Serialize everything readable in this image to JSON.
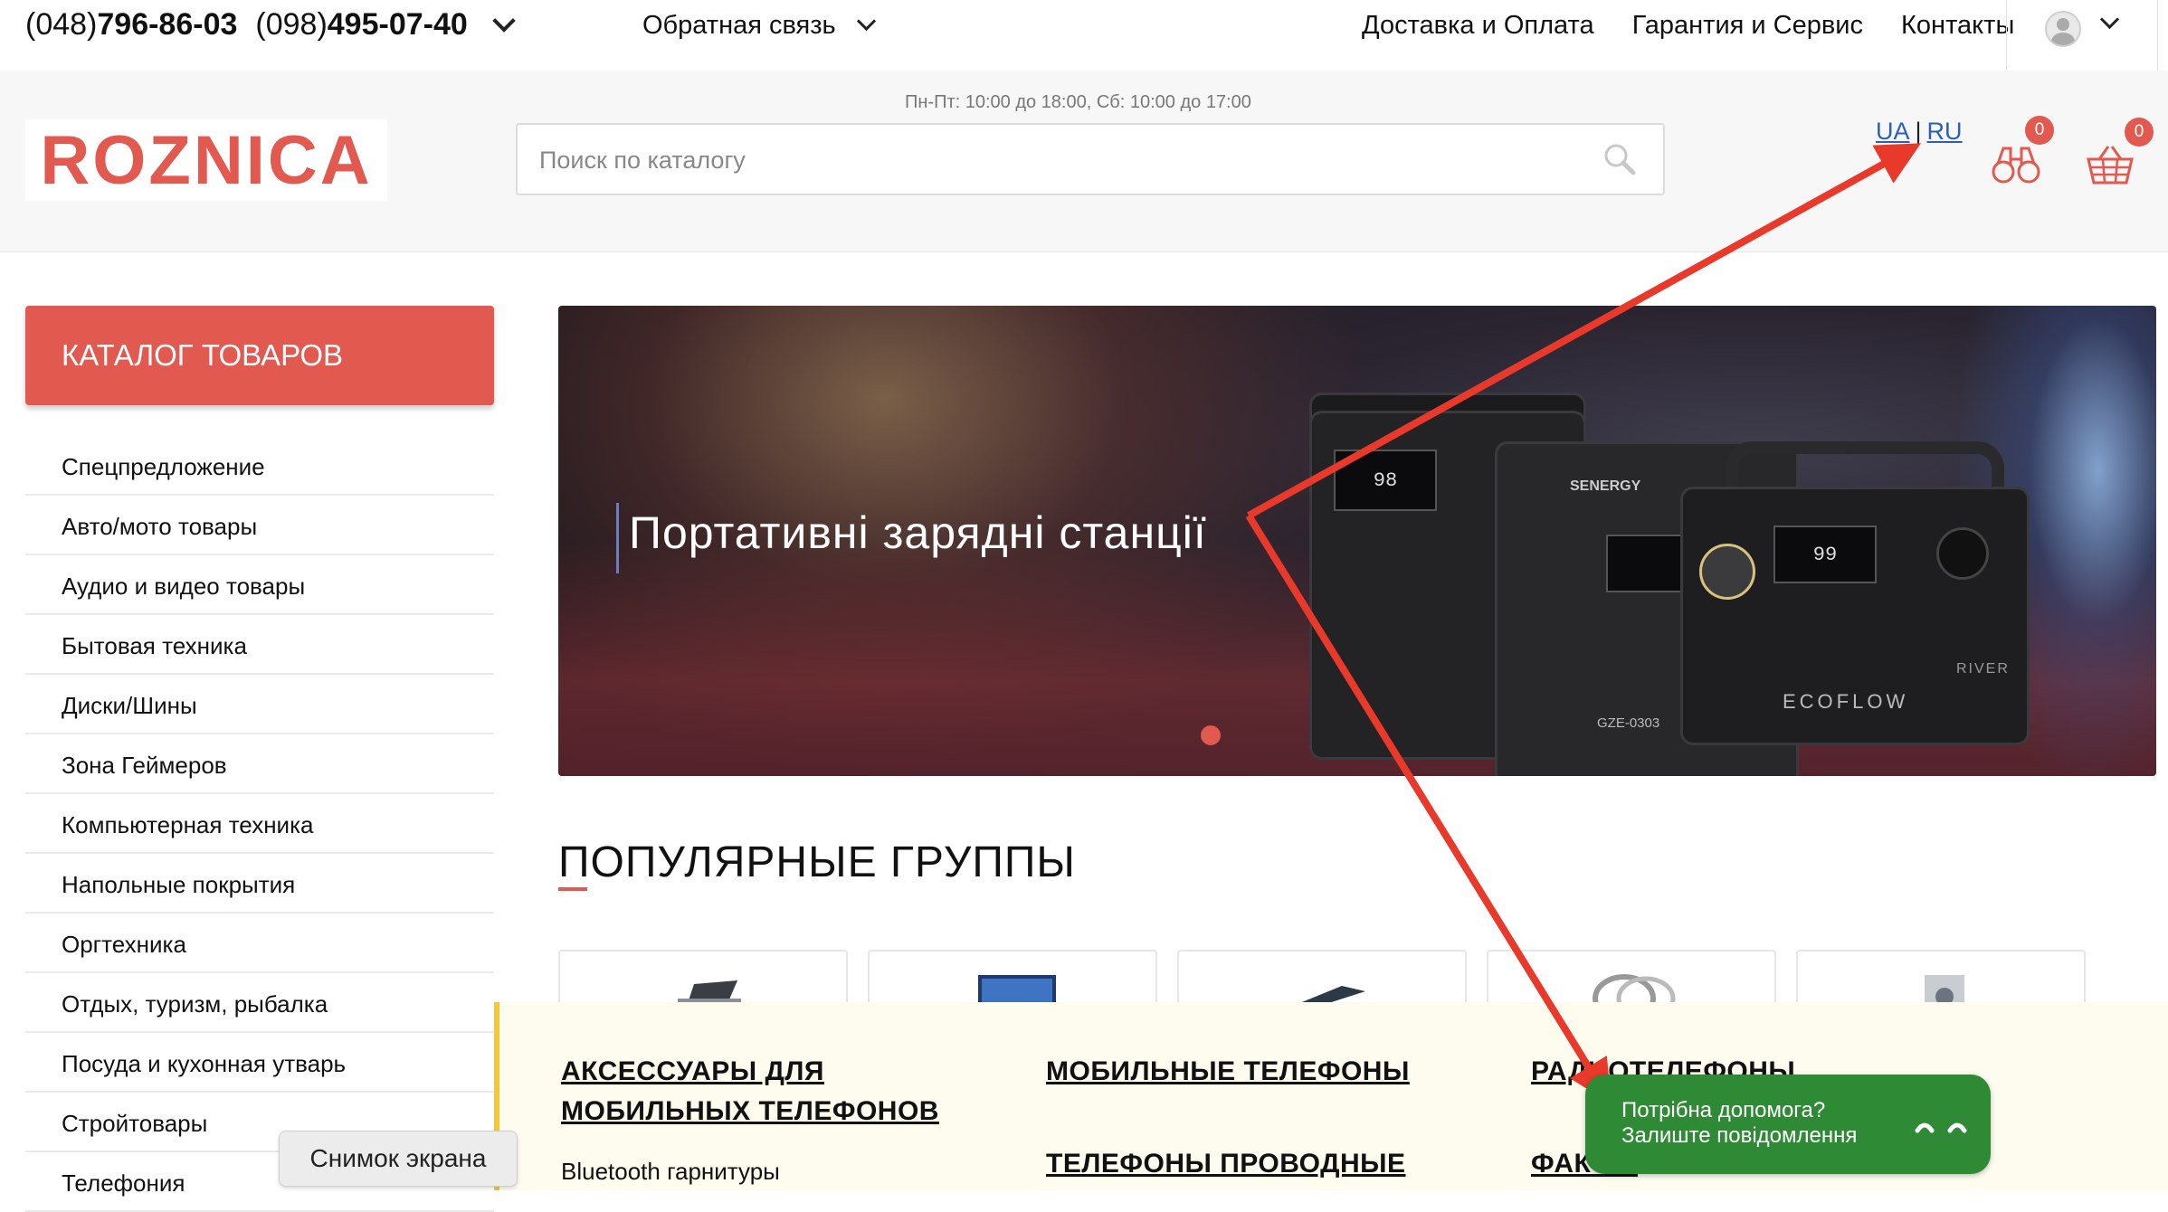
{
  "topbar": {
    "phone1_code": "(048)",
    "phone1_number": "796-86-03",
    "phone2_code": "(098)",
    "phone2_number": "495-07-40",
    "feedback": "Обратная связь",
    "nav": [
      "Доставка и Оплата",
      "Гарантия и Сервис",
      "Контакты"
    ]
  },
  "header": {
    "logo": "ROZNICA",
    "hours": "Пн-Пт: 10:00 до 18:00, Сб: 10:00 до 17:00",
    "search_placeholder": "Поиск по каталогу",
    "lang_ua": "UA",
    "lang_sep": "|",
    "lang_ru": "RU",
    "compare_count": "0",
    "cart_count": "0"
  },
  "sidebar": {
    "catalog_label": "КАТАЛОГ ТОВАРОВ",
    "items": [
      "Спецпредложение",
      "Авто/мото товары",
      "Аудио и видео товары",
      "Бытовая техника",
      "Диски/Шины",
      "Зона Геймеров",
      "Компьютерная техника",
      "Напольные покрытия",
      "Оргтехника",
      "Отдых, туризм, рыбалка",
      "Посуда и кухонная утварь",
      "Стройтовары",
      "Телефония"
    ]
  },
  "banner": {
    "title": "Портативні зарядні станції",
    "screen1": "98",
    "screen2": "99",
    "label_senergy": "SENERGY",
    "label_model": "GZE-0303",
    "label_brand": "ECOFLOW",
    "label_river": "RIVER"
  },
  "popular": {
    "title": "ПОПУЛЯРНЫЕ ГРУППЫ"
  },
  "dropdown": {
    "col1_title_line1": "АКСЕССУАРЫ ДЛЯ",
    "col1_title_line2": "МОБИЛЬНЫХ ТЕЛЕФОНОВ",
    "col1_sub": "Bluetooth гарнитуры",
    "col2_title": "МОБИЛЬНЫЕ ТЕЛЕФОНЫ",
    "col2_title2": "ТЕЛЕФОНЫ ПРОВОДНЫЕ",
    "col3_title": "РАДИОТЕЛЕФОНЫ",
    "col3_title2": "ФАКСЫ"
  },
  "overlays": {
    "screenshot_tooltip": "Снимок экрана",
    "help_line1": "Потрібна допомога?",
    "help_line2": "Залиште повідомлення"
  },
  "colors": {
    "brand": "#e2594f",
    "help_green": "#2f8a36",
    "annotation_arrow": "#e8392a"
  }
}
